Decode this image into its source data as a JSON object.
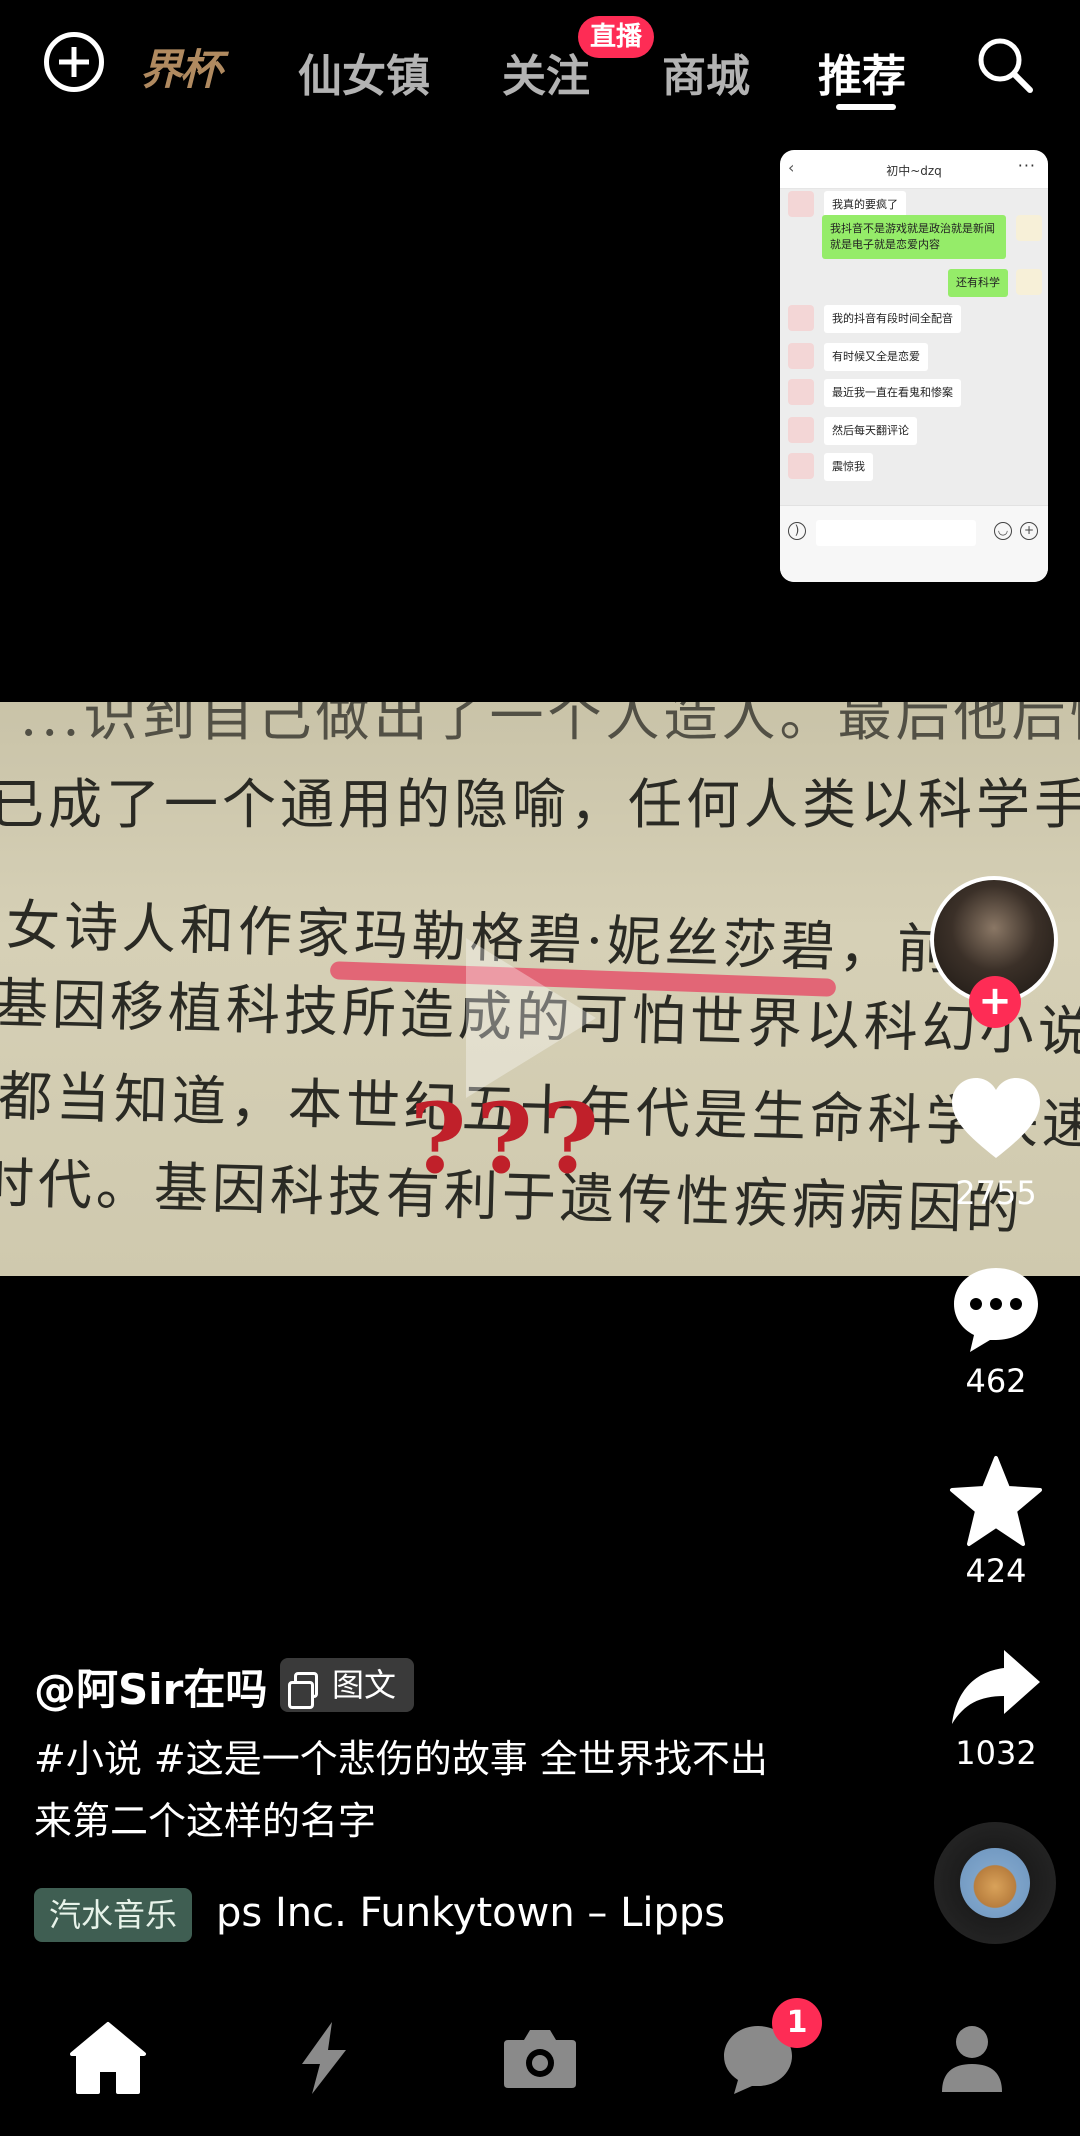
{
  "top_nav": {
    "brand": "界杯",
    "tabs": [
      {
        "label": "仙女镇"
      },
      {
        "label": "关注"
      },
      {
        "label": "商城"
      },
      {
        "label": "推荐"
      }
    ],
    "live_badge": "直播",
    "active_tab": "推荐"
  },
  "pip_chat": {
    "title": "初中~dzq",
    "messages": [
      {
        "side": "left",
        "text": "我真的要疯了"
      },
      {
        "side": "right",
        "text": "我抖音不是游戏就是政治就是新闻 就是电子就是恋爱内容"
      },
      {
        "side": "right",
        "text": "还有科学"
      },
      {
        "side": "left",
        "text": "我的抖音有段时间全配音"
      },
      {
        "side": "left",
        "text": "有时候又全是恋爱"
      },
      {
        "side": "left",
        "text": "最近我一直在看鬼和惨案"
      },
      {
        "side": "left",
        "text": "然后每天翻评论"
      },
      {
        "side": "left",
        "text": "震惊我"
      }
    ]
  },
  "post_image": {
    "lines": [
      "...识到自己做出了一个人造人。最后他后悔莫及",
      "已成了一个通用的隐喻，任何人类以科学手段创造",
      "女诗人和作家玛勒格碧·妮丝莎碧，前所",
      "基因移植科技所造成的可怕世界以科幻小说的",
      "都当知道，本世纪五十年代是生命科学快速",
      "时代。基因科技有利于遗传性疾病病因的"
    ],
    "question_marks": "???"
  },
  "right_rail": {
    "follow_symbol": "+",
    "likes": "2755",
    "comments": "462",
    "favorites": "424",
    "shares": "1032"
  },
  "caption": {
    "author": "@阿Sir在吗",
    "type_pill": "图文",
    "description": "#小说 #这是一个悲伤的故事 全世界找不出来第二个这样的名字",
    "music_tag": "汽水音乐",
    "music_text": "ps Inc.    Funkytown – Lipps"
  },
  "bottom_nav": {
    "message_badge": "1"
  },
  "colors": {
    "accent": "#fe2c55",
    "background": "#000000",
    "music_tag_bg": "#3f5e52"
  }
}
